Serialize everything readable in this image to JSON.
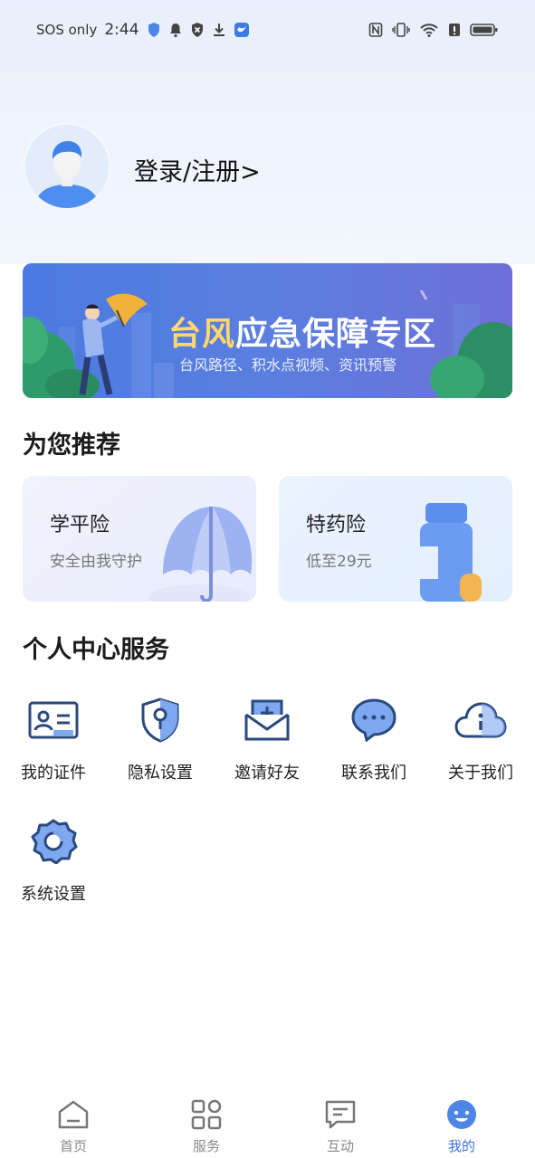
{
  "status_bar": {
    "carrier": "SOS only",
    "time": "2:44",
    "left_icons": [
      "shield-icon",
      "bell-icon",
      "block-icon",
      "download-icon",
      "bird-app-icon"
    ],
    "right_icons": [
      "nfc-icon",
      "vibrate-icon",
      "wifi-icon",
      "alert-icon",
      "battery-icon"
    ]
  },
  "profile": {
    "login_label": "登录/注册>"
  },
  "banner": {
    "title_highlight": "台风",
    "title_rest": "应急保障专区",
    "subtitle": "台风路径、积水点视频、资讯预警"
  },
  "recommend": {
    "title": "为您推荐",
    "cards": [
      {
        "title": "学平险",
        "subtitle": "安全由我守护",
        "icon": "umbrella-icon"
      },
      {
        "title": "特药险",
        "subtitle": "低至29元",
        "icon": "medicine-bottle-icon"
      }
    ]
  },
  "services": {
    "title": "个人中心服务",
    "items": [
      {
        "label": "我的证件",
        "icon": "id-card-icon"
      },
      {
        "label": "隐私设置",
        "icon": "privacy-shield-icon"
      },
      {
        "label": "邀请好友",
        "icon": "invite-mail-icon"
      },
      {
        "label": "联系我们",
        "icon": "chat-bubble-icon"
      },
      {
        "label": "关于我们",
        "icon": "info-cloud-icon"
      },
      {
        "label": "系统设置",
        "icon": "gear-icon"
      }
    ]
  },
  "nav": {
    "items": [
      {
        "label": "首页",
        "icon": "home-icon",
        "active": false
      },
      {
        "label": "服务",
        "icon": "grid-icon",
        "active": false
      },
      {
        "label": "互动",
        "icon": "message-icon",
        "active": false
      },
      {
        "label": "我的",
        "icon": "profile-face-icon",
        "active": true
      }
    ]
  },
  "colors": {
    "accent": "#3a73d9",
    "banner_yellow": "#ffd86b",
    "icon_dark": "#2b4a7c",
    "icon_blue": "#4d86e8"
  }
}
